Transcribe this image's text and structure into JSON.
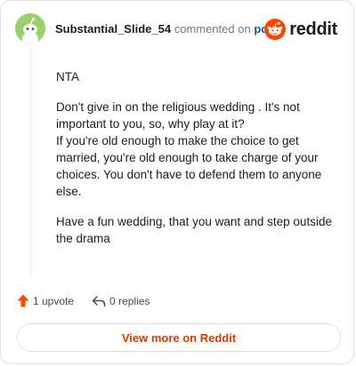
{
  "comment": {
    "username": "Substantial_Slide_54",
    "action_text": "commented on",
    "post_link": "post",
    "paragraphs": [
      "NTA",
      "Don't give in on the religious wedding . It's not important to you, so, why play at it?\nIf you're old enough to make the choice to get married, you're old enough to take charge of your choices. You don't have to defend them to anyone else.",
      "Have a fun wedding, that you want and step outside the drama"
    ]
  },
  "brand": {
    "logo_text": "reddit",
    "color": "#ff4500"
  },
  "actions": {
    "upvotes": "1 upvote",
    "replies": "0 replies"
  },
  "footer": {
    "view_more": "View more on Reddit"
  },
  "icons": {
    "avatar": "snoo-avatar-icon",
    "logo": "reddit-logo-icon",
    "upvote": "upvote-arrow-icon",
    "reply": "reply-arrow-icon"
  }
}
